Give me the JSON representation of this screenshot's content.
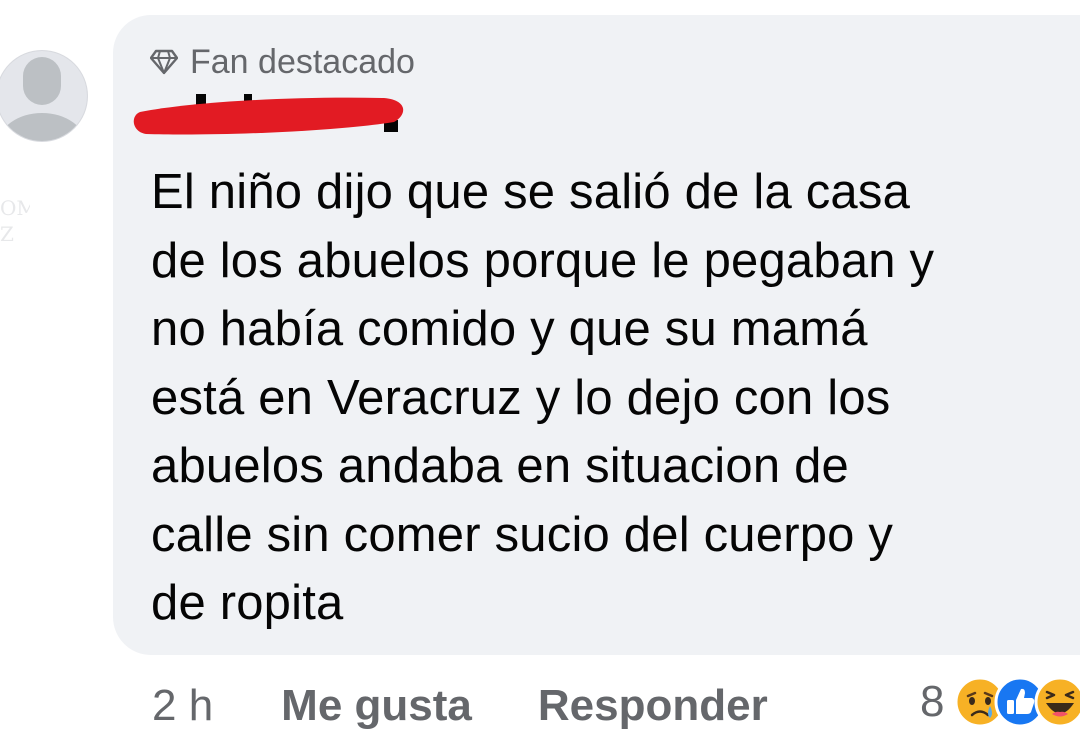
{
  "comment": {
    "badge": {
      "icon": "diamond-icon",
      "label": "Fan destacado"
    },
    "author": {
      "redacted": true,
      "redaction_color": "#e21b23"
    },
    "text": "El niño dijo que se salió de la casa\nde los abuelos porque le pegaban y\nno había comido y que su mamá\nestá en Veracruz y lo dejo con los\nabuelos andaba en situacion de\ncalle sin comer sucio del cuerpo y\nde ropita"
  },
  "actions": {
    "time": "2 h",
    "like_label": "Me gusta",
    "reply_label": "Responder"
  },
  "reactions": {
    "count": "8",
    "icons": [
      "sad-reaction-icon",
      "like-reaction-icon",
      "haha-reaction-icon"
    ]
  },
  "colors": {
    "bubble": "#f0f2f5",
    "secondary_text": "#65676b",
    "primary_text": "#050505",
    "like_blue": "#1877f2",
    "reaction_yellow": "#f7b125"
  }
}
